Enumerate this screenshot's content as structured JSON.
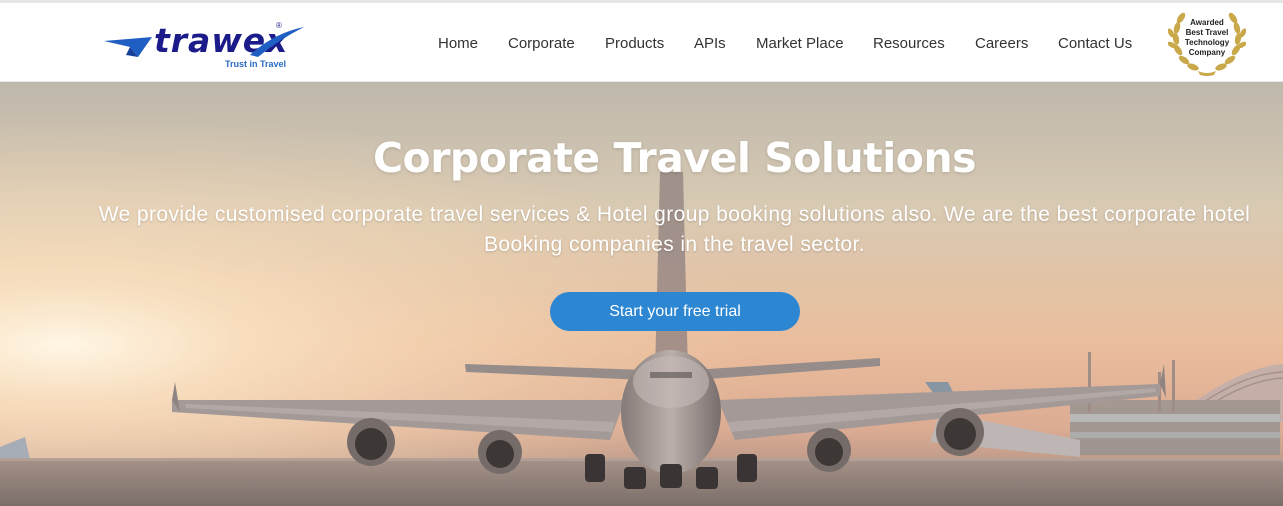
{
  "brand": {
    "name": "trawex",
    "registered_mark": "®",
    "tagline": "Trust in Travel",
    "color": "#1b1b8a",
    "accent": "#2a6bc4"
  },
  "nav": {
    "items": [
      {
        "label": "Home"
      },
      {
        "label": "Corporate"
      },
      {
        "label": "Products"
      },
      {
        "label": "APIs"
      },
      {
        "label": "Market Place"
      },
      {
        "label": "Resources"
      },
      {
        "label": "Careers"
      },
      {
        "label": "Contact Us"
      }
    ]
  },
  "award": {
    "lines": [
      "Awarded",
      "Best Travel",
      "Technology",
      "Company"
    ],
    "color": "#c9a84a",
    "icon": "laurel-wreath-icon"
  },
  "hero": {
    "title": "Corporate Travel Solutions",
    "subtitle_line1": "We provide customised corporate travel services & Hotel group booking solutions also. We are the best corporate hotel",
    "subtitle_line2": "Booking companies in the travel sector.",
    "cta_label": "Start your free trial",
    "cta_color": "#2c86d1",
    "background": "airplane-on-runway-at-sunset"
  }
}
